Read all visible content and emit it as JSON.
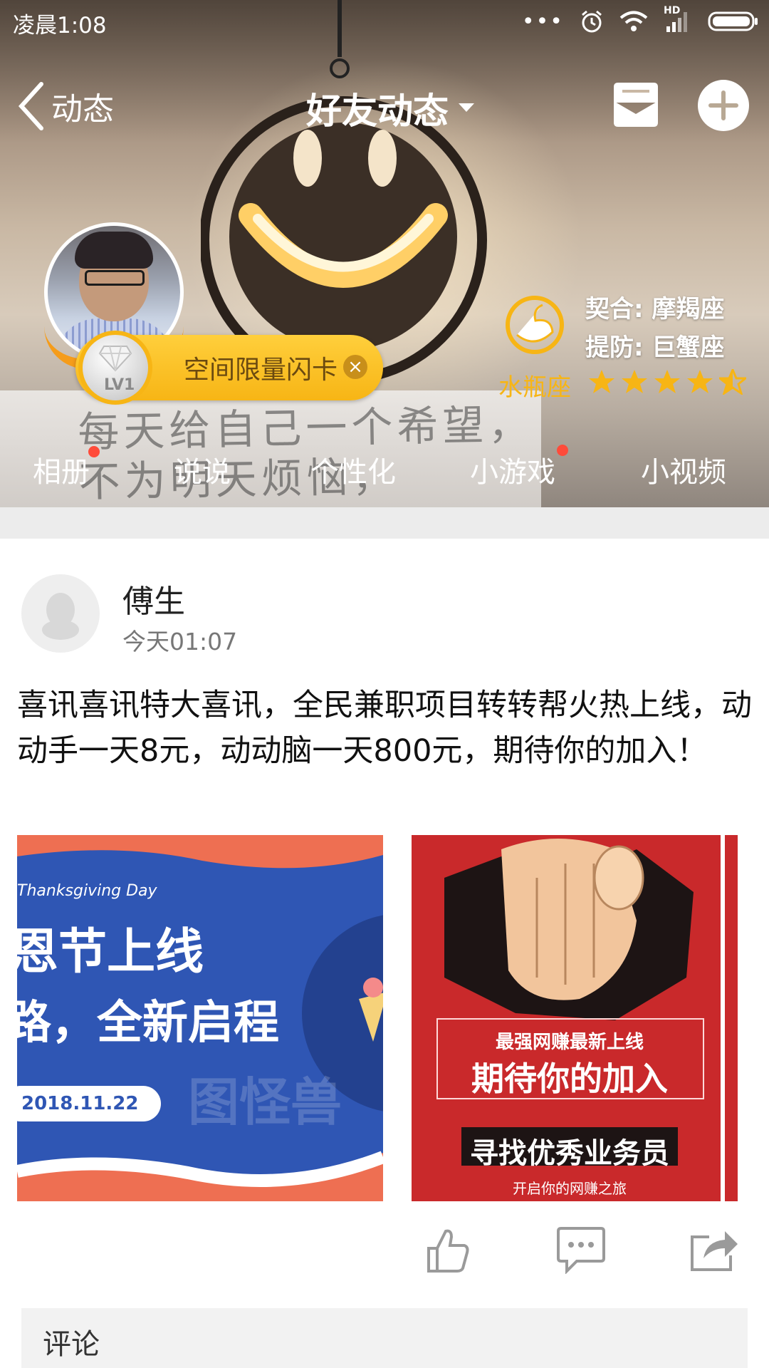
{
  "status_bar": {
    "time": "凌晨1:08",
    "network": "HD"
  },
  "nav": {
    "back_label": "动态",
    "title": "好友动态"
  },
  "profile": {
    "level": "LV1",
    "flash_card": "空间限量闪卡",
    "zodiac": {
      "match": "契合: 摩羯座",
      "guard": "提防: 巨蟹座",
      "sign": "水瓶座",
      "stars": 4.5
    },
    "cover_text": "每天给自己一个希望，\n不为明天烦恼，"
  },
  "tabs": [
    {
      "label": "相册",
      "dot": true
    },
    {
      "label": "说说",
      "dot": false
    },
    {
      "label": "个性化",
      "dot": false
    },
    {
      "label": "小游戏",
      "dot": true
    },
    {
      "label": "小视频",
      "dot": false
    }
  ],
  "post": {
    "author": "傅生",
    "time": "今天01:07",
    "text": "喜讯喜讯特大喜讯，全民兼职项目转转帮火热上线，动动手一天8元，动动脑一天800元，期待你的加入！",
    "images": [
      {
        "subtitle": "Thanksgiving Day",
        "line1": "恩节上线",
        "line2": "路，全新启程",
        "date": "2018.11.22",
        "watermark": "图怪兽"
      },
      {
        "line1": "最强网赚最新上线",
        "line2": "期待你的加入",
        "line3": "寻找优秀业务员",
        "line4": "开启你的网赚之旅"
      }
    ]
  },
  "comment": {
    "label": "评论"
  },
  "colors": {
    "accent": "#f7b515",
    "dot": "#ff4b3a",
    "poster_red": "#c9292b",
    "poster_blue": "#2f56b4"
  }
}
